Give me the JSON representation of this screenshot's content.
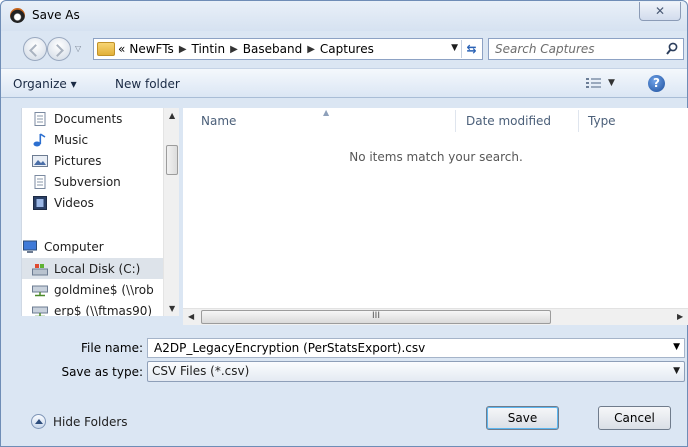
{
  "window": {
    "title": "Save As",
    "close_glyph": "✕"
  },
  "nav_buttons": {
    "back_icon": "back-arrow-icon",
    "forward_icon": "forward-arrow-icon"
  },
  "address": {
    "overflow": "«",
    "crumbs": [
      "NewFTs",
      "Tintin",
      "Baseband",
      "Captures"
    ],
    "separator": "▶",
    "refresh_glyph": "⇆"
  },
  "search": {
    "placeholder": "Search Captures"
  },
  "toolbar": {
    "organize_label": "Organize ▾",
    "new_folder_label": "New folder",
    "help_glyph": "?"
  },
  "nav_pane": {
    "items": [
      {
        "label": "Documents",
        "icon": "documents-icon"
      },
      {
        "label": "Music",
        "icon": "music-icon"
      },
      {
        "label": "Pictures",
        "icon": "pictures-icon"
      },
      {
        "label": "Subversion",
        "icon": "subversion-icon"
      },
      {
        "label": "Videos",
        "icon": "videos-icon"
      },
      {
        "label": "Computer",
        "icon": "computer-icon"
      },
      {
        "label": "Local Disk (C:)",
        "icon": "local-disk-icon",
        "selected": true
      },
      {
        "label": "goldmine$ (\\\\rob",
        "icon": "network-drive-icon"
      },
      {
        "label": "erp$ (\\\\ftmas90)",
        "icon": "network-drive-icon"
      }
    ]
  },
  "file_list": {
    "columns": [
      "Name",
      "Date modified",
      "Type"
    ],
    "empty_message": "No items match your search.",
    "hscroll_grip": "III"
  },
  "form": {
    "file_name_label": "File name:",
    "file_name_value": "A2DP_LegacyEncryption (PerStatsExport).csv",
    "save_type_label": "Save as type:",
    "save_type_value": "CSV Files (*.csv)"
  },
  "footer": {
    "hide_folders_label": "Hide Folders",
    "save_label": "Save",
    "cancel_label": "Cancel"
  }
}
